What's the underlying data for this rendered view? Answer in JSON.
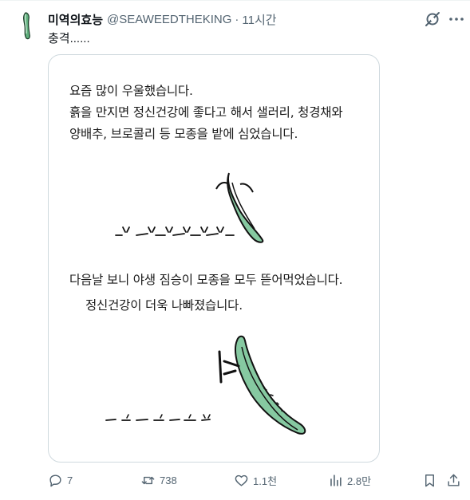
{
  "tweet": {
    "author_name": "미역의효능",
    "handle": "@SEAWEEDTHEKING",
    "separator": "·",
    "time": "11시간",
    "text": "충격......"
  },
  "image": {
    "lines": [
      "요즘 많이 우울했습니다.",
      "흙을 만지면 정신건강에 좋다고 해서 샐러리, 청경채와",
      "양배추, 브로콜리 등 모종을 밭에 심었습니다.",
      "다음날 보니 야생 짐승이 모종을 모두 뜯어먹었습니다.",
      "정신건강이 더욱 나빠졌습니다."
    ]
  },
  "actions": {
    "replies": "7",
    "retweets": "738",
    "likes": "1.1천",
    "views": "2.8만"
  },
  "icons": [
    "avatar-seaweed",
    "grok-icon",
    "more-icon",
    "reply-icon",
    "retweet-icon",
    "like-icon",
    "views-icon",
    "bookmark-icon",
    "share-icon"
  ],
  "colors": {
    "text": "#0f1419",
    "muted": "#536471",
    "border": "#cfd9de",
    "seaweed": "#7fc49a"
  }
}
